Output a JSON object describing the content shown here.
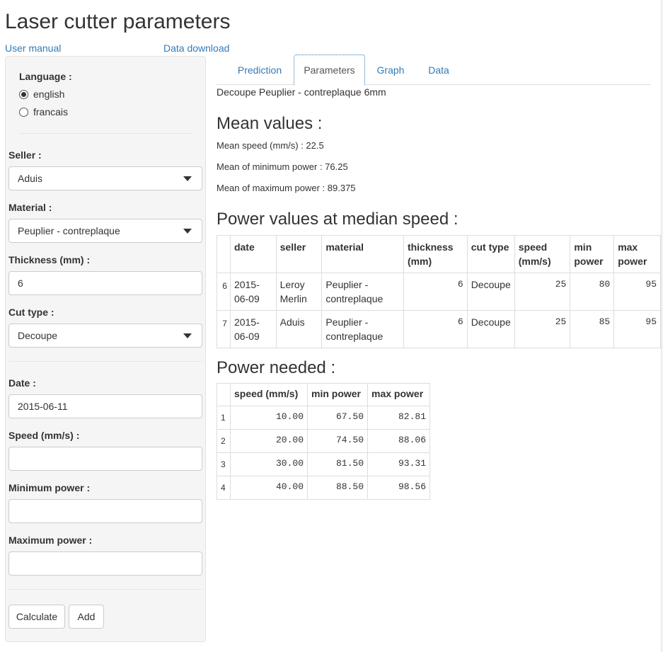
{
  "app": {
    "title": "Laser cutter parameters",
    "links": {
      "manual": "User manual",
      "download": "Data download"
    }
  },
  "sidebar": {
    "language_label": "Language :",
    "language_options": [
      "english",
      "francais"
    ],
    "language_selected": "english",
    "seller_label": "Seller :",
    "seller_value": "Aduis",
    "material_label": "Material :",
    "material_value": "Peuplier - contreplaque",
    "thickness_label": "Thickness (mm) :",
    "thickness_value": "6",
    "cut_type_label": "Cut type :",
    "cut_type_value": "Decoupe",
    "date_label": "Date :",
    "date_value": "2015-06-11",
    "speed_label": "Speed (mm/s) :",
    "speed_value": "",
    "min_power_label": "Minimum power :",
    "min_power_value": "",
    "max_power_label": "Maximum power :",
    "max_power_value": "",
    "calculate_label": "Calculate",
    "add_label": "Add"
  },
  "tabs": [
    "Prediction",
    "Parameters",
    "Graph",
    "Data"
  ],
  "active_tab": "Parameters",
  "main": {
    "subtitle": "Decoupe Peuplier - contreplaque 6mm",
    "mean_heading": "Mean values :",
    "mean_speed": "Mean speed (mm/s) : 22.5",
    "mean_min_power": "Mean of minimum power : 76.25",
    "mean_max_power": "Mean of maximum power : 89.375",
    "median_heading": "Power values at median speed :",
    "median_table": {
      "headers": [
        "",
        "date",
        "seller",
        "material",
        "thickness (mm)",
        "cut type",
        "speed (mm/s)",
        "min power",
        "max power"
      ],
      "rows": [
        [
          "6",
          "2015-06-09",
          "Leroy Merlin",
          "Peuplier - contreplaque",
          "6",
          "Decoupe",
          "25",
          "80",
          "95"
        ],
        [
          "7",
          "2015-06-09",
          "Aduis",
          "Peuplier - contreplaque",
          "6",
          "Decoupe",
          "25",
          "85",
          "95"
        ]
      ]
    },
    "needed_heading": "Power needed :",
    "needed_table": {
      "headers": [
        "",
        "speed (mm/s)",
        "min power",
        "max power"
      ],
      "rows": [
        [
          "1",
          "10.00",
          "67.50",
          "82.81"
        ],
        [
          "2",
          "20.00",
          "74.50",
          "88.06"
        ],
        [
          "3",
          "30.00",
          "81.50",
          "93.31"
        ],
        [
          "4",
          "40.00",
          "88.50",
          "98.56"
        ]
      ]
    }
  }
}
